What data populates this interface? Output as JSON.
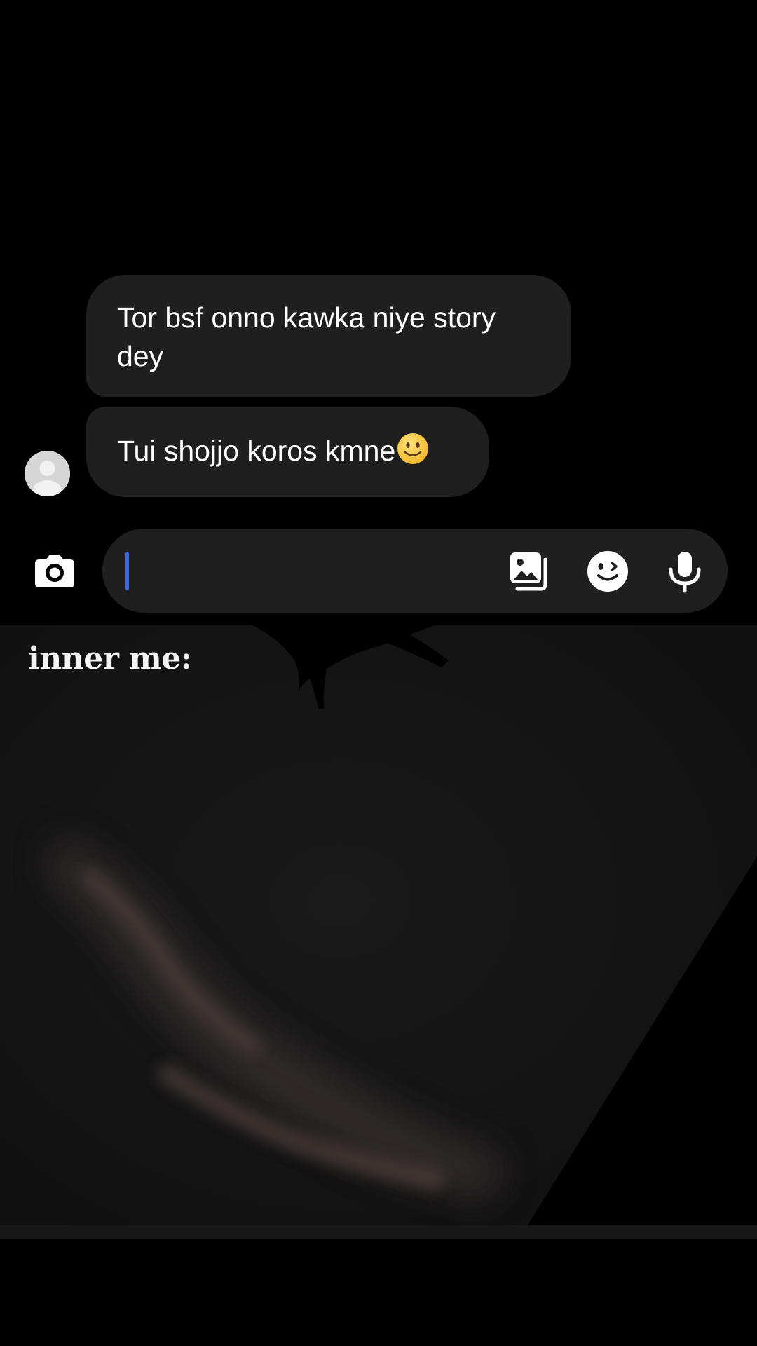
{
  "chat": {
    "messages": [
      {
        "text": "Tor bsf onno kawka niye story dey"
      },
      {
        "text": "Tui shojjo koros kmne",
        "emoji": "slightly-smiling-face"
      }
    ]
  },
  "composer": {
    "value": "",
    "placeholder": "",
    "icons": [
      "camera-icon",
      "gallery-icon",
      "sticker-icon",
      "microphone-icon"
    ]
  },
  "media": {
    "caption": "inner me:"
  },
  "colors": {
    "background": "#000000",
    "bubble": "#1f1f1f",
    "caret": "#2f6bff",
    "emoji": "#f7c33a"
  }
}
